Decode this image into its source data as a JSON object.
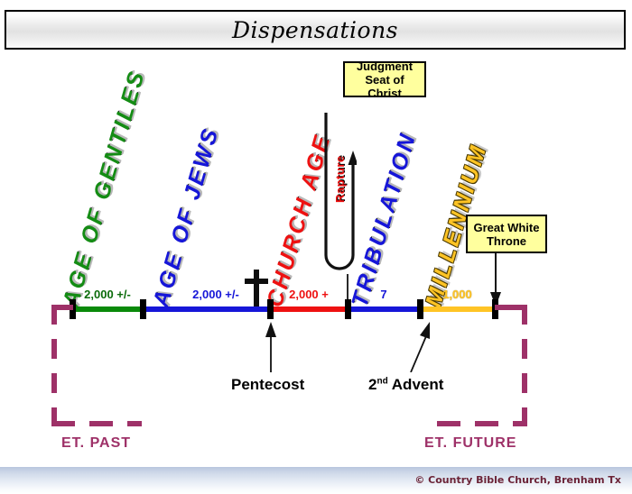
{
  "title": {
    "text": "Dispensations"
  },
  "eras": [
    {
      "name": "AGE OF GENTILES",
      "color": "#148c14",
      "duration": "2,000 +/-",
      "segment_color": "#0a8a0a"
    },
    {
      "name": "AGE OF JEWS",
      "color": "#1616d8",
      "duration": "2,000 +/-",
      "segment_color": "#1616d8"
    },
    {
      "name": "CHURCH AGE",
      "color": "#ee1111",
      "duration": "2,000 +",
      "segment_color": "#ee1111"
    },
    {
      "name": "TRIBULATION",
      "color": "#1616d8",
      "duration": "7",
      "segment_color": "#1616d8"
    },
    {
      "name": "MILLENNIUM",
      "color": "#ffc425",
      "duration": "1,000",
      "segment_color": "#ffc425"
    }
  ],
  "markers": {
    "cross": "cross-symbol",
    "rapture": "Rapture",
    "judgment_seat": "Judgment\nSeat of Christ",
    "judgment_seat_line1": "Judgment",
    "judgment_seat_line2": "Seat of Christ",
    "great_white_throne_line1": "Great White",
    "great_white_throne_line2": "Throne",
    "pentecost": "Pentecost",
    "second_advent_prefix": "2",
    "second_advent_sup": "nd",
    "second_advent_suffix": " Advent"
  },
  "brackets": {
    "past_label": "ET. PAST",
    "future_label": "ET. FUTURE",
    "color": "#9e3168"
  },
  "footer": {
    "credit": "© Country Bible Church, Brenham Tx"
  }
}
